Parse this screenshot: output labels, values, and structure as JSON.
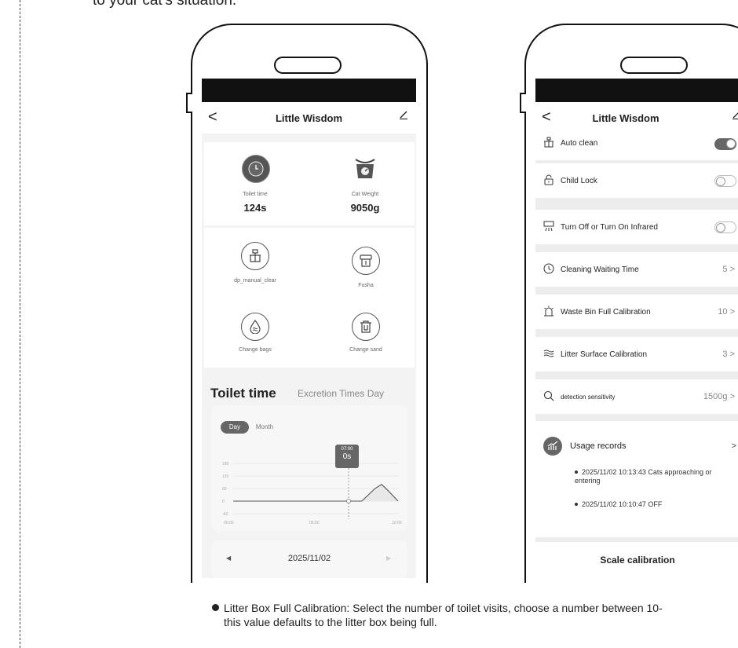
{
  "page": {
    "top_text": "to your cat's situation.",
    "bullet_line1": "Litter Box Full Calibration: Select the number of toilet visits, choose a number between 10-",
    "bullet_line2": "this value defaults to the litter box being full."
  },
  "left_phone": {
    "nav": {
      "back": "<",
      "title": "Little Wisdom"
    },
    "stats": [
      {
        "label": "Toilet time",
        "value": "124s",
        "icon": "clock-icon"
      },
      {
        "label": "Cat Weight",
        "value": "9050g",
        "icon": "scale-icon"
      }
    ],
    "actions": [
      {
        "label": "dp_manual_clear",
        "icon": "clean-icon"
      },
      {
        "label": "Fusha",
        "icon": "flush-icon"
      },
      {
        "label": "Change bags",
        "icon": "water-drop-icon"
      },
      {
        "label": "Change sand",
        "icon": "trash-icon"
      }
    ],
    "section": {
      "title": "Toilet time",
      "subtitle": "Excretion Times Day"
    },
    "tabs": {
      "day": "Day",
      "month": "Month"
    },
    "tooltip": {
      "time": "07:00",
      "value": "0s"
    },
    "date_bar": {
      "prev": "◀",
      "date": "2025/11/02",
      "next": "▶"
    }
  },
  "chart_data": {
    "type": "line",
    "title": "",
    "x": [
      "00:00",
      "05:00",
      "10:00"
    ],
    "y_ticks": [
      "180",
      "120",
      "60",
      "0",
      "-60"
    ],
    "ylim": [
      -60,
      180
    ],
    "series": [
      {
        "values": [
          [
            0,
            0
          ],
          [
            5.6,
            0
          ],
          [
            7,
            0
          ],
          [
            7.8,
            0
          ],
          [
            8.6,
            60
          ],
          [
            9,
            80
          ],
          [
            9.4,
            50
          ],
          [
            10,
            0
          ]
        ]
      }
    ],
    "xlabel": "",
    "ylabel": "",
    "grid": true
  },
  "right_phone": {
    "nav": {
      "back": "<",
      "title": "Little Wisdom"
    },
    "rows": [
      {
        "label": "Auto clean",
        "icon": "clean-icon",
        "toggle": "on"
      },
      {
        "label": "Child Lock",
        "icon": "lock-icon",
        "toggle": "off"
      },
      {
        "label": "Turn Off or Turn On Infrared",
        "icon": "infrared-icon",
        "toggle": "off"
      },
      {
        "label": "Cleaning Waiting Time",
        "icon": "timer-icon",
        "value": "5 >"
      },
      {
        "label": "Waste Bin Full Calibration",
        "icon": "alarm-icon",
        "value": "10 >"
      },
      {
        "label": "Litter Surface Calibration",
        "icon": "wave-icon",
        "value": "3 >"
      },
      {
        "label": "detection sensitivity",
        "icon": "search-icon",
        "value": "1500g >"
      }
    ],
    "usage": {
      "title": "Usage records",
      "arrow": ">",
      "records": [
        "2025/11/02 10:13:43 Cats approaching or entering",
        "2025/11/02 10:10:47 OFF"
      ]
    },
    "scale": "Scale calibration"
  }
}
